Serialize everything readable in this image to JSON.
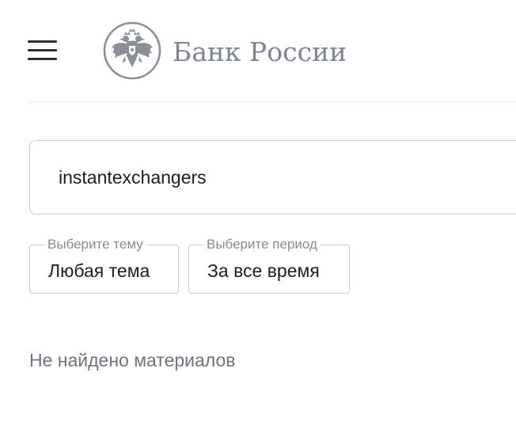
{
  "header": {
    "menu_icon": "hamburger-menu-icon",
    "logo": {
      "emblem_icon": "double-headed-eagle-emblem-icon",
      "text": "Банк России",
      "color": "#7f8590"
    }
  },
  "search": {
    "value": "instantexchangers",
    "placeholder": ""
  },
  "filters": {
    "topic": {
      "legend": "Выберите тему",
      "value": "Любая тема"
    },
    "period": {
      "legend": "Выберите период",
      "value": "За все время"
    }
  },
  "results": {
    "empty_message": "Не найдено материалов"
  }
}
